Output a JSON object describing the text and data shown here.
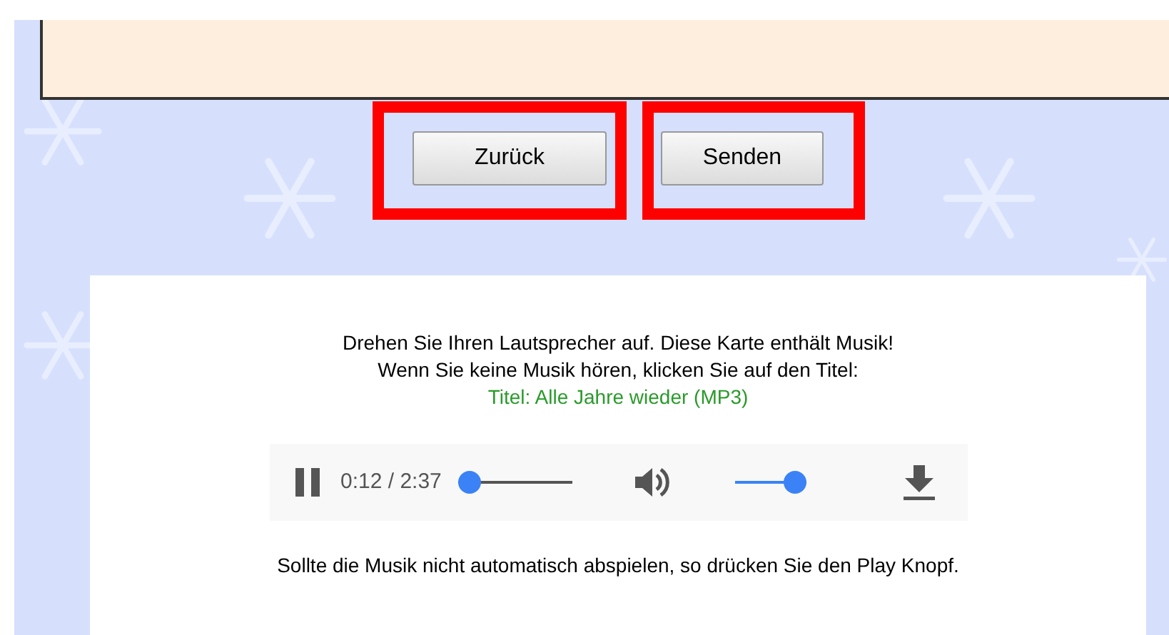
{
  "buttons": [
    {
      "label": "Zurück",
      "highlighted": true
    },
    {
      "label": "Senden",
      "highlighted": true
    }
  ],
  "card": {
    "lines": [
      "Drehen Sie Ihren Lautsprecher auf. Diese Karte enthält Musik!",
      "Wenn Sie keine Musik hören, klicken Sie auf den Titel:"
    ],
    "title_link": "Titel: Alle Jahre wieder (MP3)",
    "player": {
      "playing": true,
      "time": "0:12 / 2:37",
      "progress": {
        "level": 0.0
      },
      "volume": {
        "level": 1.0
      }
    },
    "footer": "Sollte die Musik nicht automatisch abspielen, so drücken Sie den Play Knopf."
  }
}
